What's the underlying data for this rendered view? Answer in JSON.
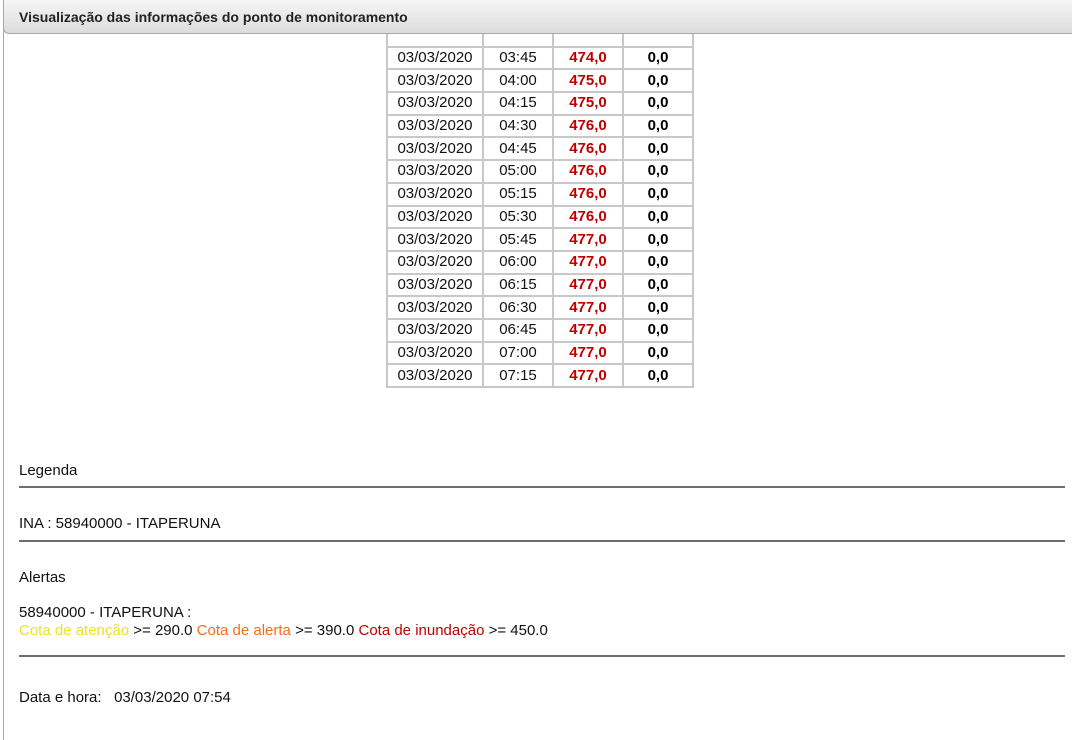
{
  "header": {
    "title": "Visualização das informações do ponto de monitoramento"
  },
  "readings": [
    {
      "date": "03/03/2020",
      "time": "03:45",
      "level": "474,0",
      "rain": "0,0"
    },
    {
      "date": "03/03/2020",
      "time": "04:00",
      "level": "475,0",
      "rain": "0,0"
    },
    {
      "date": "03/03/2020",
      "time": "04:15",
      "level": "475,0",
      "rain": "0,0"
    },
    {
      "date": "03/03/2020",
      "time": "04:30",
      "level": "476,0",
      "rain": "0,0"
    },
    {
      "date": "03/03/2020",
      "time": "04:45",
      "level": "476,0",
      "rain": "0,0"
    },
    {
      "date": "03/03/2020",
      "time": "05:00",
      "level": "476,0",
      "rain": "0,0"
    },
    {
      "date": "03/03/2020",
      "time": "05:15",
      "level": "476,0",
      "rain": "0,0"
    },
    {
      "date": "03/03/2020",
      "time": "05:30",
      "level": "476,0",
      "rain": "0,0"
    },
    {
      "date": "03/03/2020",
      "time": "05:45",
      "level": "477,0",
      "rain": "0,0"
    },
    {
      "date": "03/03/2020",
      "time": "06:00",
      "level": "477,0",
      "rain": "0,0"
    },
    {
      "date": "03/03/2020",
      "time": "06:15",
      "level": "477,0",
      "rain": "0,0"
    },
    {
      "date": "03/03/2020",
      "time": "06:30",
      "level": "477,0",
      "rain": "0,0"
    },
    {
      "date": "03/03/2020",
      "time": "06:45",
      "level": "477,0",
      "rain": "0,0"
    },
    {
      "date": "03/03/2020",
      "time": "07:00",
      "level": "477,0",
      "rain": "0,0"
    },
    {
      "date": "03/03/2020",
      "time": "07:15",
      "level": "477,0",
      "rain": "0,0"
    }
  ],
  "legend": {
    "heading": "Legenda",
    "station": "INA : 58940000 - ITAPERUNA"
  },
  "alerts": {
    "heading": "Alertas",
    "station": "58940000 - ITAPERUNA :",
    "atencao_label": "Cota de atenção",
    "atencao_value": ">= 290.0",
    "alerta_label": "Cota de alerta",
    "alerta_value": ">= 390.0",
    "inundacao_label": "Cota de inundação",
    "inundacao_value": ">= 450.0",
    "colors": {
      "atencao": "#f0e020",
      "alerta": "#ef6f1a",
      "inundacao": "#c00000"
    }
  },
  "datetime": {
    "label": "Data e hora:",
    "value": "03/03/2020 07:54"
  }
}
